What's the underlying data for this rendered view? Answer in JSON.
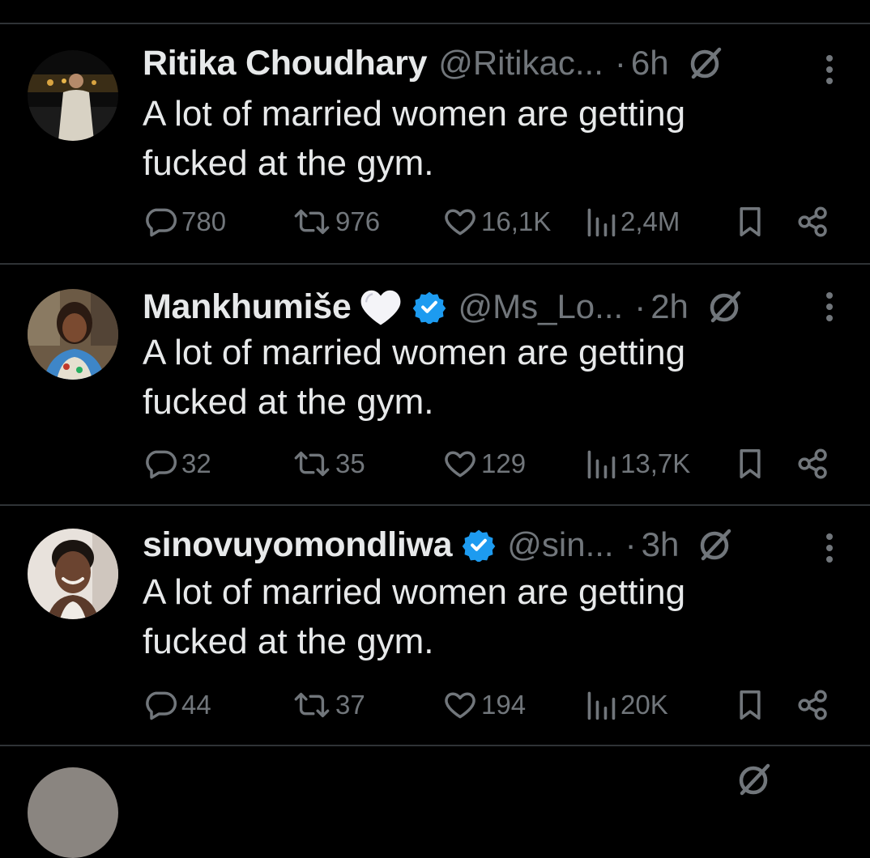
{
  "tweets": [
    {
      "name": "Ritika Choudhary",
      "handle": "@Ritikac...",
      "separator": "·",
      "time": "6h",
      "verified": false,
      "emoji": "",
      "text": "A lot of married women are getting fucked at the gym.",
      "replies": "780",
      "reposts": "976",
      "likes": "16,1K",
      "views": "2,4M"
    },
    {
      "name": "Mankhumiše",
      "handle": "@Ms_Lo...",
      "separator": "·",
      "time": "2h",
      "verified": true,
      "emoji": "white-heart-icon",
      "text": "A lot of married women are getting fucked at the gym.",
      "replies": "32",
      "reposts": "35",
      "likes": "129",
      "views": "13,7K"
    },
    {
      "name": "sinovuyomondliwa",
      "handle": "@sin...",
      "separator": "·",
      "time": "3h",
      "verified": true,
      "emoji": "",
      "text": "A lot of married women are getting fucked at the gym.",
      "replies": "44",
      "reposts": "37",
      "likes": "194",
      "views": "20K"
    }
  ],
  "icons": {
    "reply": "reply-icon",
    "repost": "repost-icon",
    "like": "heart-icon",
    "views": "views-icon",
    "bookmark": "bookmark-icon",
    "share": "share-icon",
    "grok": "grok-icon",
    "more": "more-icon",
    "verified": "verified-badge-icon"
  },
  "colors": {
    "background": "#000000",
    "text": "#e7e9ea",
    "secondary": "#71767b",
    "divider": "#2f3336",
    "verified": "#1d9bf0"
  }
}
